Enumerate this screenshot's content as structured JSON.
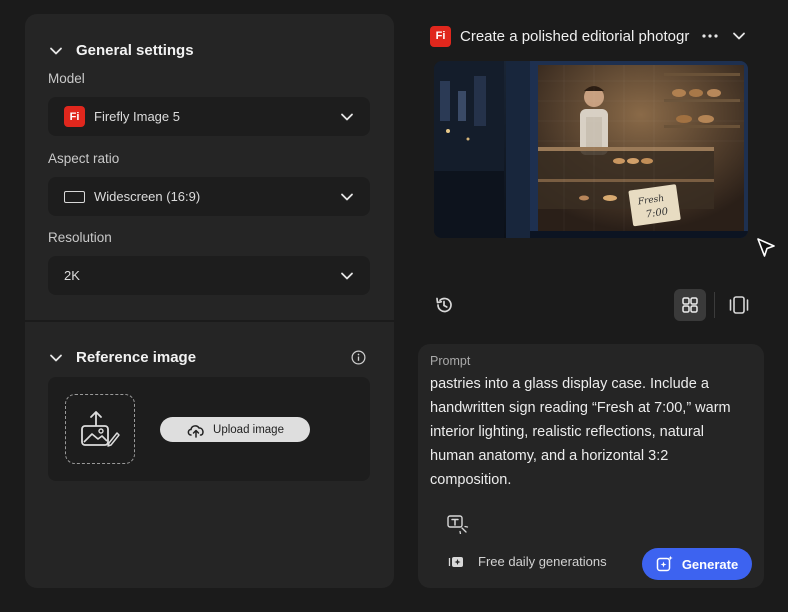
{
  "left_panel": {
    "general": {
      "heading": "General settings",
      "model_label": "Model",
      "model_value": "Firefly Image 5",
      "model_badge": "Fi",
      "aspect_label": "Aspect ratio",
      "aspect_value": "Widescreen (16:9)",
      "resolution_label": "Resolution",
      "resolution_value": "2K"
    },
    "reference": {
      "heading": "Reference image",
      "upload_label": "Upload image"
    }
  },
  "header": {
    "badge": "Fi",
    "title": "Create a polished editorial photogra"
  },
  "preview": {
    "sign_line1": "Fresh",
    "sign_line2": "7:00"
  },
  "prompt": {
    "label": "Prompt",
    "text": "pastries into a glass display case. Include a handwritten sign reading “Fresh at 7:00,” warm interior lighting, realistic reflections, natural human anatomy, and a horizontal 3:2 composition.",
    "free_label": "Free daily generations",
    "generate_label": "Generate"
  },
  "colors": {
    "accent": "#3d63f0",
    "brand": "#e0271d",
    "panel": "#252525",
    "background": "#1b1b1b"
  }
}
